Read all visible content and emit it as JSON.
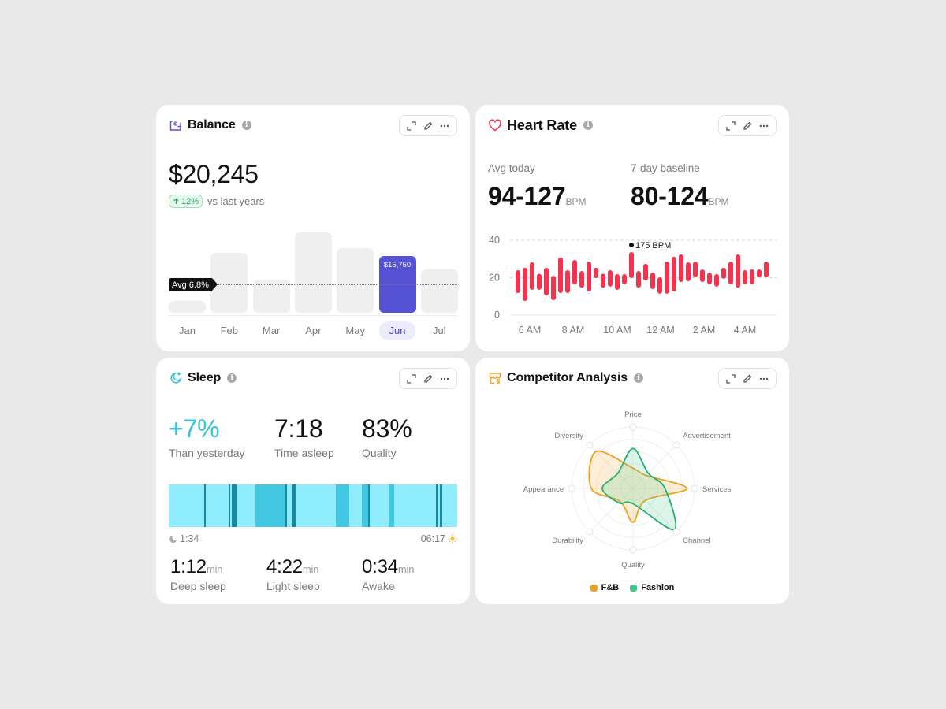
{
  "balance": {
    "title": "Balance",
    "amount": "$20,245",
    "change": "12%",
    "change_text": "vs last years",
    "avg_label": "Avg 6.8%",
    "accent": "#5552d6",
    "selected_month": "Jun",
    "months": [
      "Jan",
      "Feb",
      "Mar",
      "Apr",
      "May",
      "Jun",
      "Jul"
    ],
    "values": [
      3300,
      16600,
      9200,
      22300,
      17900,
      15750,
      12000
    ],
    "selected_label": "$15,750",
    "avg_value": 6800
  },
  "heart_rate": {
    "title": "Heart Rate",
    "accent": "#f5334f",
    "avg_today_label": "Avg today",
    "avg_today_value": "94-127",
    "baseline_label": "7-day baseline",
    "baseline_value": "80-124",
    "unit": "BPM",
    "peak_label": "175 BPM",
    "chart_data": {
      "type": "bar",
      "title": "Heart Rate",
      "ylim": [
        0,
        40
      ],
      "y_ticks": [
        "0",
        "20",
        "40"
      ],
      "x_ticks": [
        "6 AM",
        "8 AM",
        "10 AM",
        "12 AM",
        "2 AM",
        "4 AM"
      ],
      "peak_index": 16,
      "ranges": [
        [
          11.8,
          24
        ],
        [
          7.6,
          25.3
        ],
        [
          13.5,
          28.2
        ],
        [
          13.5,
          22.1
        ],
        [
          10.5,
          25.3
        ],
        [
          8,
          21
        ],
        [
          11.8,
          30.8
        ],
        [
          11.8,
          24
        ],
        [
          16.4,
          29.5
        ],
        [
          14.7,
          23.6
        ],
        [
          12.6,
          28.6
        ],
        [
          19.8,
          25.3
        ],
        [
          14.7,
          22.1
        ],
        [
          15.2,
          24
        ],
        [
          13.5,
          21.9
        ],
        [
          16.4,
          21.9
        ],
        [
          19.8,
          33.7
        ],
        [
          14.7,
          23.6
        ],
        [
          18.5,
          27.4
        ],
        [
          13.9,
          22.7
        ],
        [
          11.4,
          20.2
        ],
        [
          11.4,
          28.6
        ],
        [
          12.6,
          31.2
        ],
        [
          17.7,
          32.4
        ],
        [
          18.1,
          28.2
        ],
        [
          20.2,
          28.6
        ],
        [
          17.7,
          24.4
        ],
        [
          16.4,
          22.7
        ],
        [
          15.2,
          21.9
        ],
        [
          19.4,
          25.3
        ],
        [
          16.4,
          28.6
        ],
        [
          14.7,
          32.4
        ],
        [
          16.4,
          24
        ],
        [
          16.4,
          24.4
        ],
        [
          20.2,
          24.4
        ],
        [
          20.2,
          28.6
        ]
      ]
    }
  },
  "sleep": {
    "title": "Sleep",
    "accent": "#35c2e0",
    "change_value": "+7%",
    "change_label": "Than yesterday",
    "time_value": "7:18",
    "time_label": "Time asleep",
    "quality_value": "83%",
    "quality_label": "Quality",
    "start_time": "1:34",
    "end_time": "06:17",
    "unit": "min",
    "details": [
      {
        "value": "1:12",
        "label": "Deep sleep"
      },
      {
        "value": "4:22",
        "label": "Light sleep"
      },
      {
        "value": "0:34",
        "label": "Awake"
      }
    ],
    "stage_colors": {
      "light": "#8fecfc",
      "medium": "#42c7e2",
      "dark": "#168aa3"
    },
    "segments": [
      {
        "stage": "dark",
        "start": 0.123,
        "end": 0.128
      },
      {
        "stage": "dark",
        "start": 0.208,
        "end": 0.213
      },
      {
        "stage": "dark",
        "start": 0.219,
        "end": 0.235
      },
      {
        "stage": "medium",
        "start": 0.301,
        "end": 0.404
      },
      {
        "stage": "dark",
        "start": 0.404,
        "end": 0.41
      },
      {
        "stage": "dark",
        "start": 0.428,
        "end": 0.443
      },
      {
        "stage": "medium",
        "start": 0.579,
        "end": 0.626
      },
      {
        "stage": "medium",
        "start": 0.669,
        "end": 0.691
      },
      {
        "stage": "dark",
        "start": 0.691,
        "end": 0.697
      },
      {
        "stage": "medium",
        "start": 0.762,
        "end": 0.781
      },
      {
        "stage": "dark",
        "start": 0.926,
        "end": 0.932
      },
      {
        "stage": "dark",
        "start": 0.94,
        "end": 0.948
      }
    ]
  },
  "competitor": {
    "title": "Competitor Analysis",
    "chart_data": {
      "type": "radar",
      "axes": [
        "Price",
        "Advertisement",
        "Services",
        "Channel",
        "Quality",
        "Durability",
        "Appearance",
        "Diversity"
      ],
      "range": [
        0,
        1
      ],
      "rings": 5,
      "series": [
        {
          "name": "F&B",
          "color": "#f0a020",
          "values": [
            0.33,
            0.3,
            0.88,
            0.28,
            0.55,
            0.3,
            0.68,
            0.85
          ]
        },
        {
          "name": "Fashion",
          "color": "#27b06e",
          "values": [
            0.65,
            0.35,
            0.52,
            0.95,
            0.25,
            0.33,
            0.5,
            0.35
          ]
        }
      ],
      "legend": "bottom"
    }
  },
  "toolbar": {
    "expand": "expand-icon",
    "edit": "pencil-icon",
    "more": "more-icon"
  }
}
